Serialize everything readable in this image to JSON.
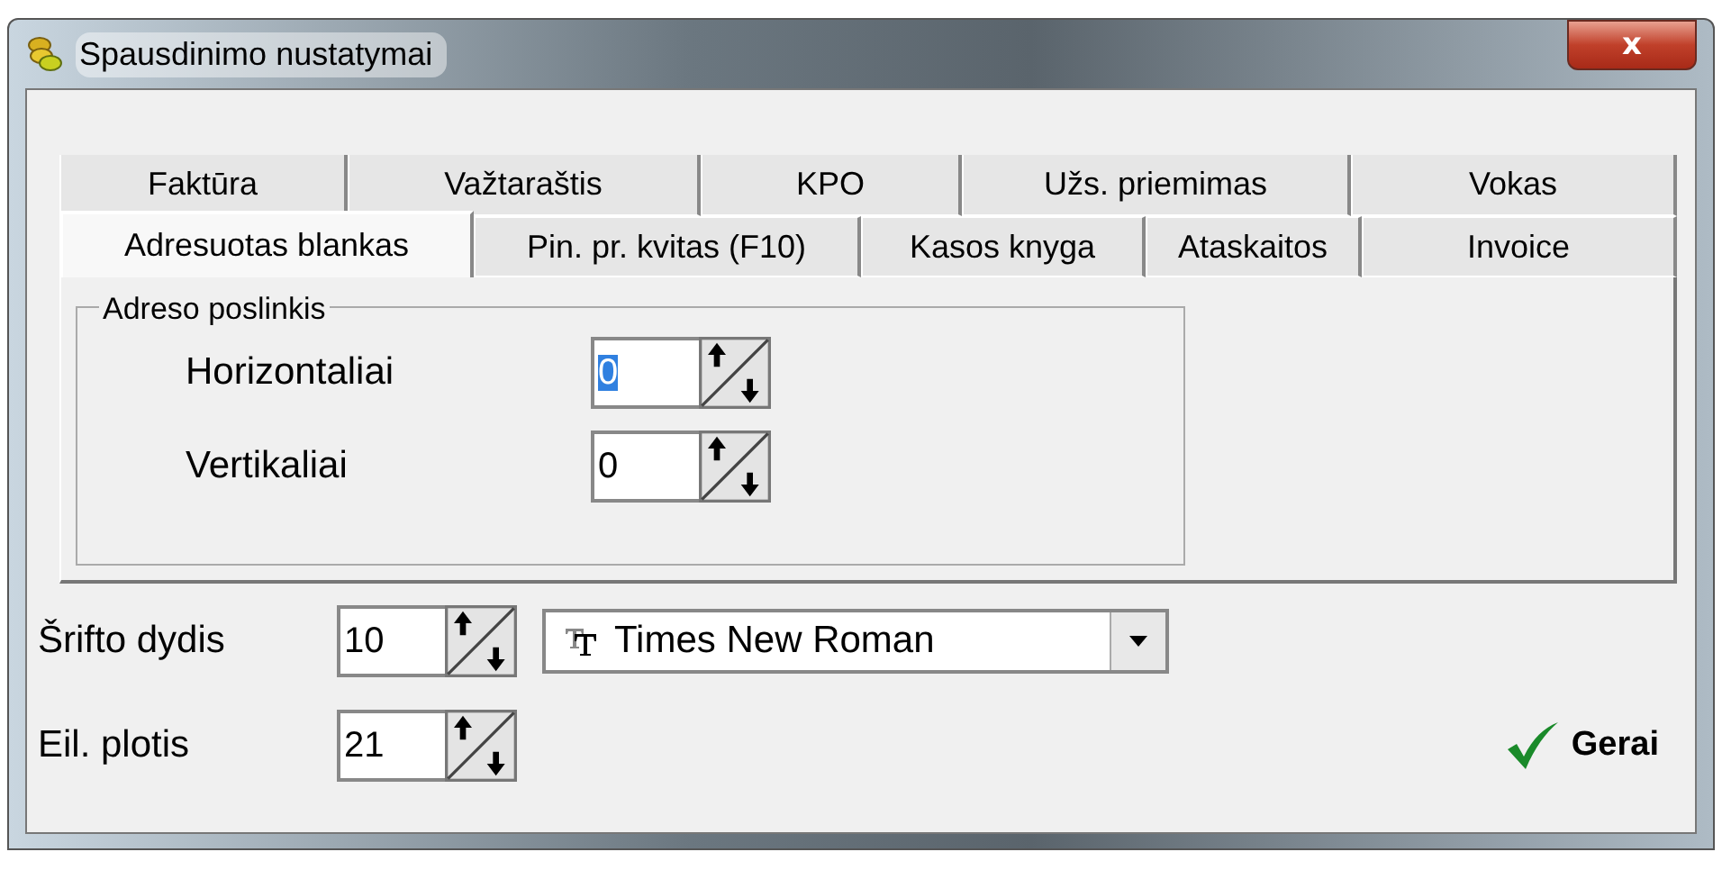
{
  "window": {
    "title": "Spausdinimo nustatymai",
    "close": "x"
  },
  "tab_rows": [
    [
      {
        "label": "Faktūra",
        "selected": false
      },
      {
        "label": "Važtaraštis",
        "selected": false
      },
      {
        "label": "KPO",
        "selected": false
      },
      {
        "label": "Užs. priemimas",
        "selected": false
      },
      {
        "label": "Vokas",
        "selected": false
      }
    ],
    [
      {
        "label": "Adresuotas blankas",
        "selected": true
      },
      {
        "label": "Pin. pr. kvitas (F10)",
        "selected": false
      },
      {
        "label": "Kasos knyga",
        "selected": false
      },
      {
        "label": "Ataskaitos",
        "selected": false
      },
      {
        "label": "Invoice",
        "selected": false
      }
    ]
  ],
  "group": {
    "title": "Adreso poslinkis",
    "fields": [
      {
        "label": "Horizontaliai",
        "value": "0",
        "text_selected": true
      },
      {
        "label": "Vertikaliai",
        "value": "0",
        "text_selected": false
      }
    ]
  },
  "font_size": {
    "label": "Šrifto dydis",
    "value": "10"
  },
  "font": {
    "value": "Times New Roman"
  },
  "line_width": {
    "label": "Eil. plotis",
    "value": "21"
  },
  "ok_button": {
    "label": "Gerai"
  }
}
